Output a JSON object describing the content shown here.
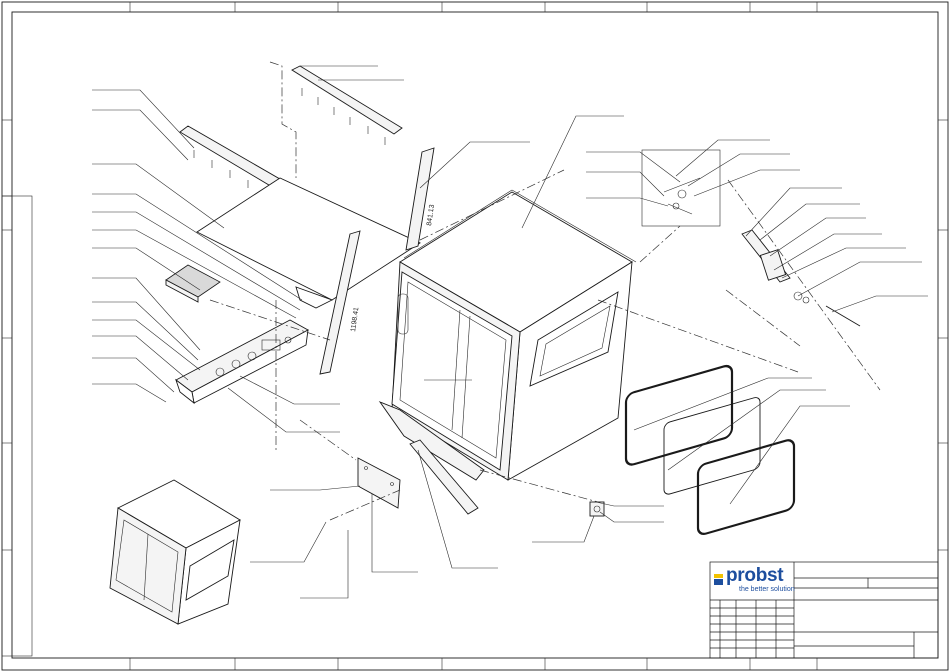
{
  "drawing": {
    "dimension_labels": [
      "841.13",
      "1198.41"
    ]
  },
  "title_block": {
    "brand": {
      "name": "probst",
      "tagline": "the better solution",
      "colors": {
        "brand_blue": "#1d4e9e",
        "mark_yellow": "#f2c200"
      }
    }
  }
}
